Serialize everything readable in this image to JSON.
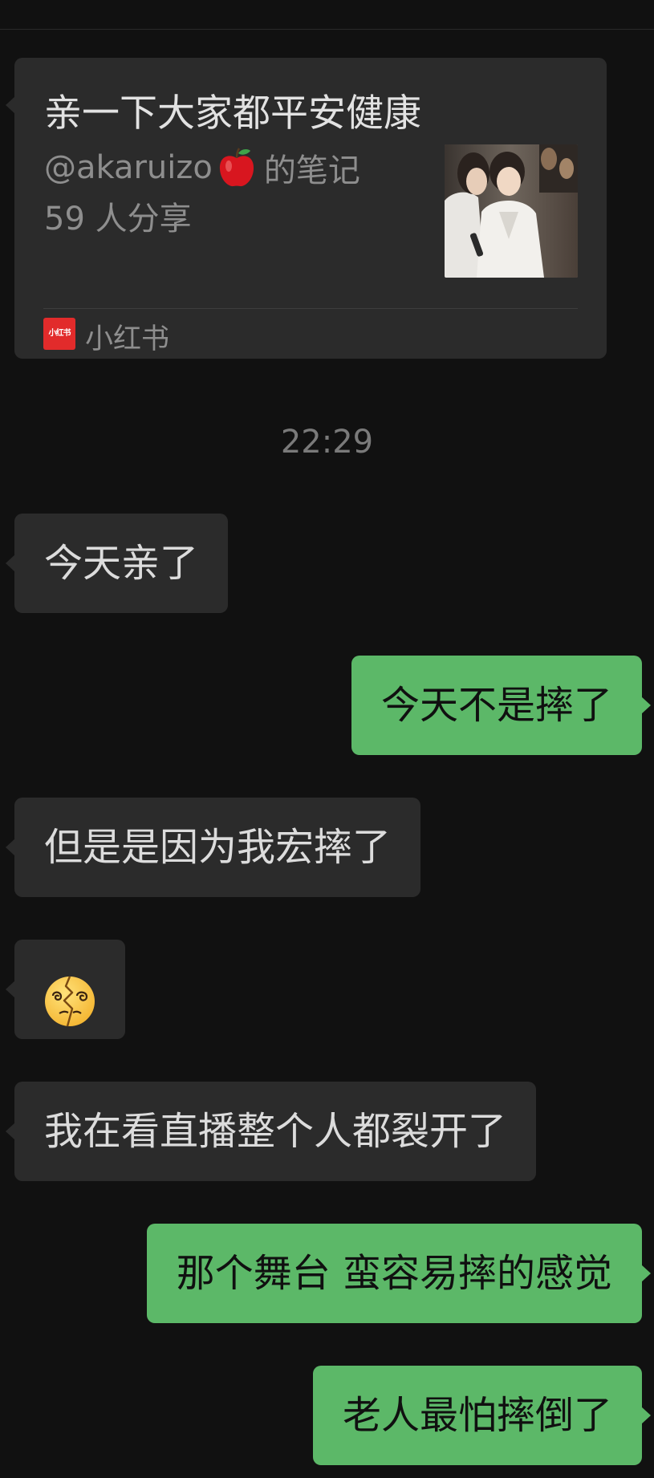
{
  "link_card": {
    "title": "亲一下大家都平安健康",
    "author": "@akaruizo",
    "author_suffix": "的笔记",
    "shares": "59 人分享",
    "source_name": "小红书",
    "source_logo_text": "小红书",
    "thumbnail": "photo-thumbnail",
    "apple_icon": "apple-emoji-icon"
  },
  "timestamp": "22:29",
  "messages": [
    {
      "side": "in",
      "text": "今天亲了"
    },
    {
      "side": "out",
      "text": "今天不是摔了"
    },
    {
      "side": "in",
      "text": "但是是因为我宏摔了"
    },
    {
      "side": "in",
      "emoji": "face-with-spiral-eyes-cracked-emoji"
    },
    {
      "side": "in",
      "text": "我在看直播整个人都裂开了"
    },
    {
      "side": "out",
      "text": "那个舞台 蛮容易摔的感觉"
    },
    {
      "side": "out",
      "text": "老人最怕摔倒了"
    }
  ],
  "colors": {
    "background": "#111111",
    "incoming_bubble": "#2b2b2b",
    "outgoing_bubble": "#5cb868",
    "xiaohongshu_red": "#e22b2b"
  }
}
